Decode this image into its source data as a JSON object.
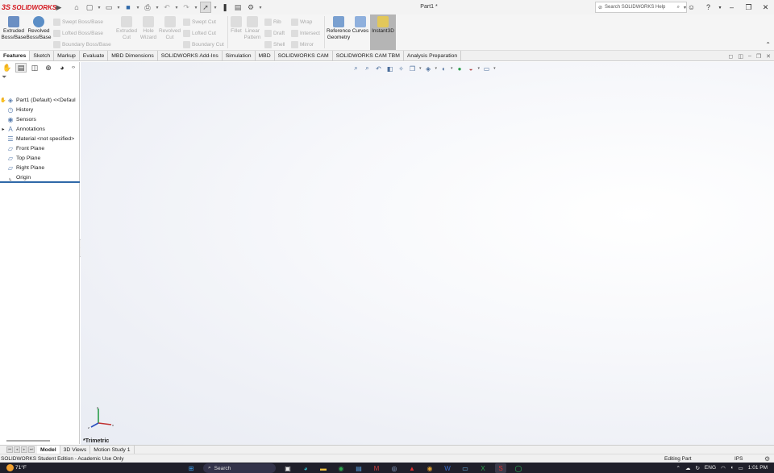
{
  "app": {
    "logo_ds": "3S",
    "logo_text": "SOLIDWORKS",
    "doc_title": "Part1 *"
  },
  "search": {
    "placeholder": "Search SOLIDWORKS Help"
  },
  "ribbon": {
    "extruded_boss": "Extruded Boss/Base",
    "revolved_boss": "Revolved Boss/Base",
    "swept_boss": "Swept Boss/Base",
    "lofted_boss": "Lofted Boss/Base",
    "boundary_boss": "Boundary Boss/Base",
    "extruded_cut": "Extruded Cut",
    "hole_wizard": "Hole Wizard",
    "revolved_cut": "Revolved Cut",
    "swept_cut": "Swept Cut",
    "lofted_cut": "Lofted Cut",
    "boundary_cut": "Boundary Cut",
    "fillet": "Fillet",
    "linear_pattern": "Linear Pattern",
    "rib": "Rib",
    "draft": "Draft",
    "shell": "Shell",
    "wrap": "Wrap",
    "intersect": "Intersect",
    "mirror": "Mirror",
    "reference_geometry": "Reference Geometry",
    "curves": "Curves",
    "instant3d": "Instant3D"
  },
  "tabs": [
    "Features",
    "Sketch",
    "Markup",
    "Evaluate",
    "MBD Dimensions",
    "SOLIDWORKS Add-Ins",
    "Simulation",
    "MBD",
    "SOLIDWORKS CAM",
    "SOLIDWORKS CAM TBM",
    "Analysis Preparation"
  ],
  "tree": {
    "part": "Part1 (Default) <<Defaul",
    "history": "History",
    "sensors": "Sensors",
    "annotations": "Annotations",
    "material": "Material <not specified>",
    "front_plane": "Front Plane",
    "top_plane": "Top Plane",
    "right_plane": "Right Plane",
    "origin": "Origin"
  },
  "viewport": {
    "view_label": "*Trimetric",
    "axis_x": "x",
    "axis_y": "y",
    "axis_z": "z"
  },
  "model_tabs": [
    "Model",
    "3D Views",
    "Motion Study 1"
  ],
  "status": {
    "edition": "SOLIDWORKS Student Edition - Academic Use Only",
    "state": "Editing Part",
    "units": "IPS"
  },
  "taskbar": {
    "temperature": "71°F",
    "search_label": "Search",
    "language": "ENG",
    "time": "1:01 PM"
  },
  "colors": {
    "accent": "#2f68a8",
    "logo_red": "#d4171e",
    "instant3d_bg": "#b5b5b5"
  }
}
